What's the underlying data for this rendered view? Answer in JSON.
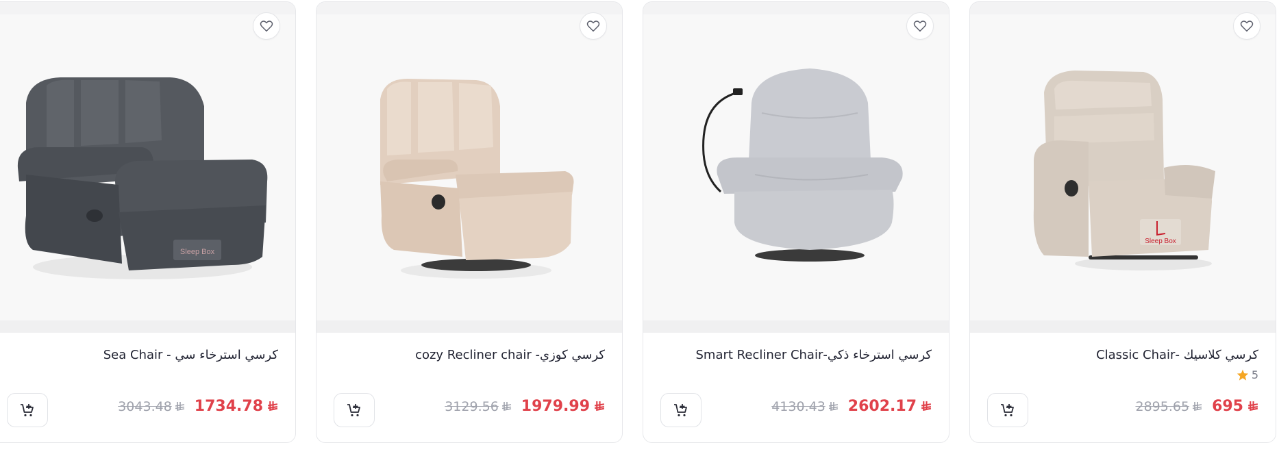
{
  "currency": {
    "symbol_name": "saudi-riyal-icon"
  },
  "products": [
    {
      "title": "كرسي استرخاء سي - Sea Chair",
      "price": "1734.78",
      "old_price": "3043.48",
      "rating": null,
      "chair_color": "#4b4f55",
      "brand_label": "Sleep Box"
    },
    {
      "title": "كرسي كوزي- cozy Recliner chair",
      "price": "1979.99",
      "old_price": "3129.56",
      "rating": null,
      "chair_color": "#e5d3c4",
      "brand_label": ""
    },
    {
      "title": "كرسي استرخاء ذكي-Smart Recliner Chair",
      "price": "2602.17",
      "old_price": "4130.43",
      "rating": null,
      "chair_color": "#c7c9cf",
      "brand_label": ""
    },
    {
      "title": "كرسي كلاسيك -Classic Chair",
      "price": "695",
      "old_price": "2895.65",
      "rating": "5",
      "chair_color": "#d8cdc2",
      "brand_label": "Sleep Box"
    }
  ],
  "colors": {
    "price_accent": "#e0414a",
    "star": "#f5a623",
    "text": "#1f2130"
  }
}
